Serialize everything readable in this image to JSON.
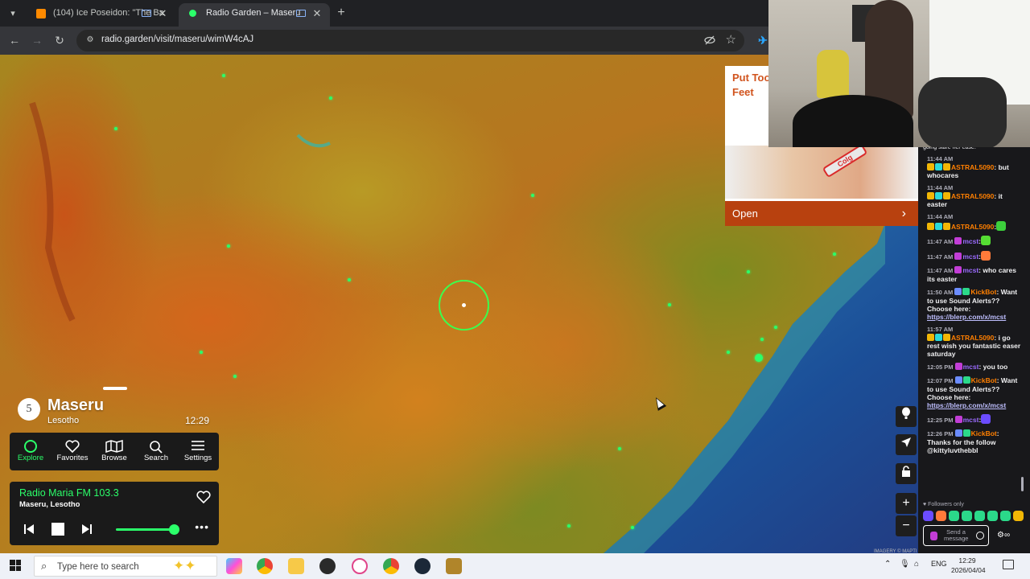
{
  "browser": {
    "tabs": [
      {
        "title": "(104) Ice Poseidon: \"The Ba",
        "favicon_color": "#ff8a00",
        "active": false
      },
      {
        "title": "Radio Garden – Maseru",
        "favicon_color": "#2bff6a",
        "active": true
      }
    ],
    "url": "radio.garden/visit/maseru/wimW4cAJ"
  },
  "radio_garden": {
    "station_count": "5",
    "city": "Maseru",
    "country": "Lesotho",
    "local_time": "12:29",
    "nav": [
      {
        "label": "Explore",
        "icon": "explore-circle-icon",
        "active": true
      },
      {
        "label": "Favorites",
        "icon": "heart-icon",
        "active": false
      },
      {
        "label": "Browse",
        "icon": "map-icon",
        "active": false
      },
      {
        "label": "Search",
        "icon": "search-icon",
        "active": false
      },
      {
        "label": "Settings",
        "icon": "menu-icon",
        "active": false
      }
    ],
    "player": {
      "station": "Radio Maria FM 103.3",
      "place": "Maseru, Lesotho",
      "volume": 0.9
    }
  },
  "map_controls": [
    "balloon-icon",
    "locate-icon",
    "lock-icon",
    "zoom-in-icon",
    "zoom-out-icon"
  ],
  "map_attribution": "IMAGERY © MAPTI",
  "ad": {
    "title_line1": "Put Too",
    "title_line2": "Feet",
    "product_text": "Colg",
    "cta": "Open"
  },
  "chat": {
    "trimmed_top": "going stare her ease.",
    "messages": [
      {
        "time": "11:44 AM",
        "user": "ASTRAL5090",
        "user_class": "u-astral",
        "text": ": but whocares",
        "badges": [
          "#f2b705",
          "#2bd9d9",
          "#f2b705"
        ]
      },
      {
        "time": "11:44 AM",
        "user": "ASTRAL5090",
        "user_class": "u-astral",
        "text": ": it easter",
        "badges": [
          "#f2b705",
          "#2bd9d9",
          "#f2b705"
        ]
      },
      {
        "time": "11:44 AM",
        "user": "ASTRAL5090",
        "user_class": "u-astral",
        "text": ":",
        "badges": [
          "#f2b705",
          "#2bd9d9",
          "#f2b705"
        ],
        "emote": "#3ccf3c"
      },
      {
        "time": "11:47 AM",
        "user": "mcst",
        "user_class": "u-mcst",
        "text": ":",
        "inline": true,
        "badges": [
          "#c23dd6"
        ],
        "emote": "#55dd33"
      },
      {
        "time": "11:47 AM",
        "user": "mcst",
        "user_class": "u-mcst",
        "text": ":",
        "inline": true,
        "badges": [
          "#c23dd6"
        ],
        "emote": "#ff7a3a"
      },
      {
        "time": "11:47 AM",
        "user": "mcst",
        "user_class": "u-mcst",
        "text": ": who cares its easter",
        "inline": true,
        "badges": [
          "#c23dd6"
        ]
      },
      {
        "time": "11:50 AM",
        "user": "KickBot",
        "user_class": "u-kick",
        "text": ": Want to use Sound Alerts?? Choose here:",
        "inline": true,
        "badges": [
          "#6b8cff",
          "#2bd98a"
        ],
        "link": "https://blerp.com/x/mcst"
      },
      {
        "time": "11:57 AM",
        "user": "ASTRAL5090",
        "user_class": "u-astral",
        "text": ": i go rest wish you fantastic easer saturday",
        "badges": [
          "#f2b705",
          "#2bd9d9",
          "#f2b705"
        ]
      },
      {
        "time": "12:05 PM",
        "user": "mcst",
        "user_class": "u-mcst",
        "text": ": you too",
        "inline": true,
        "badges": [
          "#c23dd6"
        ]
      },
      {
        "time": "12:07 PM",
        "user": "KickBot",
        "user_class": "u-kick",
        "text": ": Want to use Sound Alerts?? Choose here:",
        "inline": true,
        "badges": [
          "#6b8cff",
          "#2bd98a"
        ],
        "link": "https://blerp.com/x/mcst"
      },
      {
        "time": "12:25 PM",
        "user": "mcst",
        "user_class": "u-mcst",
        "text": ":",
        "inline": true,
        "badges": [
          "#c23dd6"
        ],
        "emote": "#6b4cff"
      },
      {
        "time": "12:26 PM",
        "user": "KickBot",
        "user_class": "u-kick",
        "text": ": Thanks for the follow @kittyluvthebbl",
        "inline": true,
        "badges": [
          "#6b8cff",
          "#2bd98a"
        ]
      }
    ],
    "mode": "Followers only",
    "input_placeholder": "Send a message",
    "emote_bar": [
      "#6b4cff",
      "#ff7a3a",
      "#2bd98a",
      "#2bd98a",
      "#2bd98a",
      "#2bd98a",
      "#2bd98a",
      "#f2b705"
    ]
  },
  "taskbar": {
    "search_placeholder": "Type here to search",
    "apps": [
      "copilot-icon",
      "chrome-icon",
      "file-explorer-icon",
      "obs-icon",
      "snipping-icon",
      "chrome-alt-icon",
      "steam-icon",
      "game-icon"
    ],
    "language": "ENG",
    "time": "12:29",
    "date": "2026/04/04"
  }
}
